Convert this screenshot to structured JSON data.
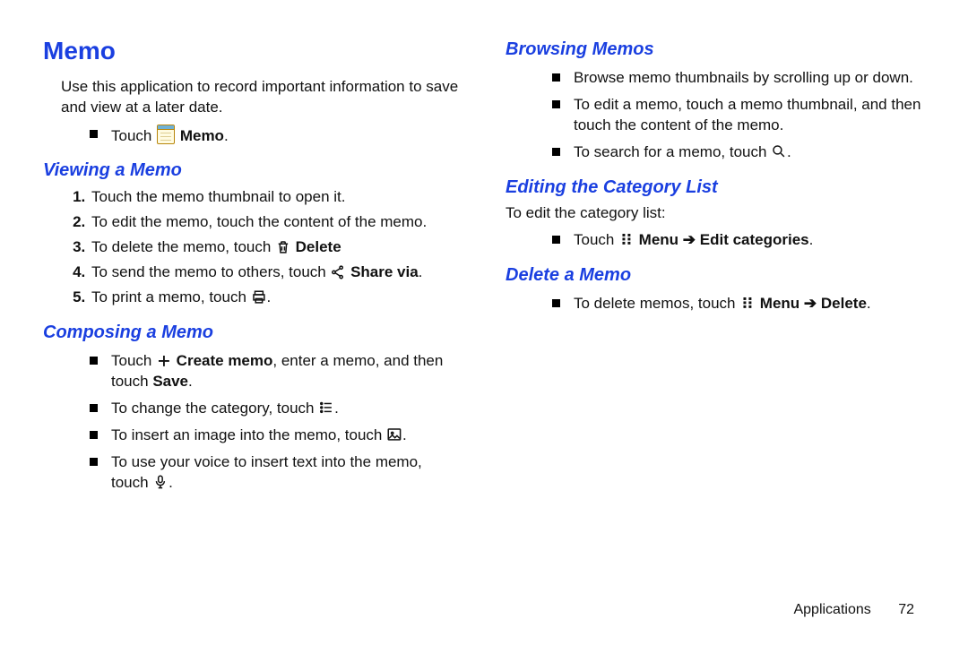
{
  "title": "Memo",
  "intro": "Use this application to record important information to save and view at a later date.",
  "touch_memo": {
    "prefix": "Touch ",
    "bold": "Memo",
    "suffix": "."
  },
  "viewing": {
    "heading": "Viewing a Memo",
    "items": [
      {
        "text": "Touch the memo thumbnail to open it."
      },
      {
        "text": "To edit the memo, touch the content of the memo."
      },
      {
        "prefix": "To delete the memo, touch ",
        "bold": "Delete"
      },
      {
        "prefix": "To send the memo to others, touch ",
        "bold": "Share via",
        "suffix": "."
      },
      {
        "prefix": "To print a memo, touch ",
        "suffix": "."
      }
    ]
  },
  "composing": {
    "heading": "Composing a Memo",
    "items": [
      {
        "prefix": "Touch ",
        "bold": "Create memo",
        "mid": ", enter a memo, and then touch ",
        "bold2": "Save",
        "suffix": "."
      },
      {
        "prefix": "To change the category, touch ",
        "suffix": "."
      },
      {
        "prefix": "To insert an image into the memo, touch ",
        "suffix": "."
      },
      {
        "prefix": "To use your voice to insert text into the memo, touch ",
        "suffix": "."
      }
    ]
  },
  "browsing": {
    "heading": "Browsing Memos",
    "items": [
      {
        "text": "Browse memo thumbnails by scrolling up or down."
      },
      {
        "text": "To edit a memo, touch a memo thumbnail, and then touch the content of the memo."
      },
      {
        "prefix": "To search for a memo, touch ",
        "suffix": "."
      }
    ]
  },
  "editing_cat": {
    "heading": "Editing the Category List",
    "intro": "To edit the category list:",
    "item": {
      "prefix": "Touch ",
      "bold": "Menu ➔ Edit categories",
      "suffix": "."
    }
  },
  "delete": {
    "heading": "Delete a Memo",
    "item": {
      "prefix": "To delete memos, touch ",
      "bold": "Menu ➔ Delete",
      "suffix": "."
    }
  },
  "footer": {
    "section": "Applications",
    "page": "72"
  }
}
